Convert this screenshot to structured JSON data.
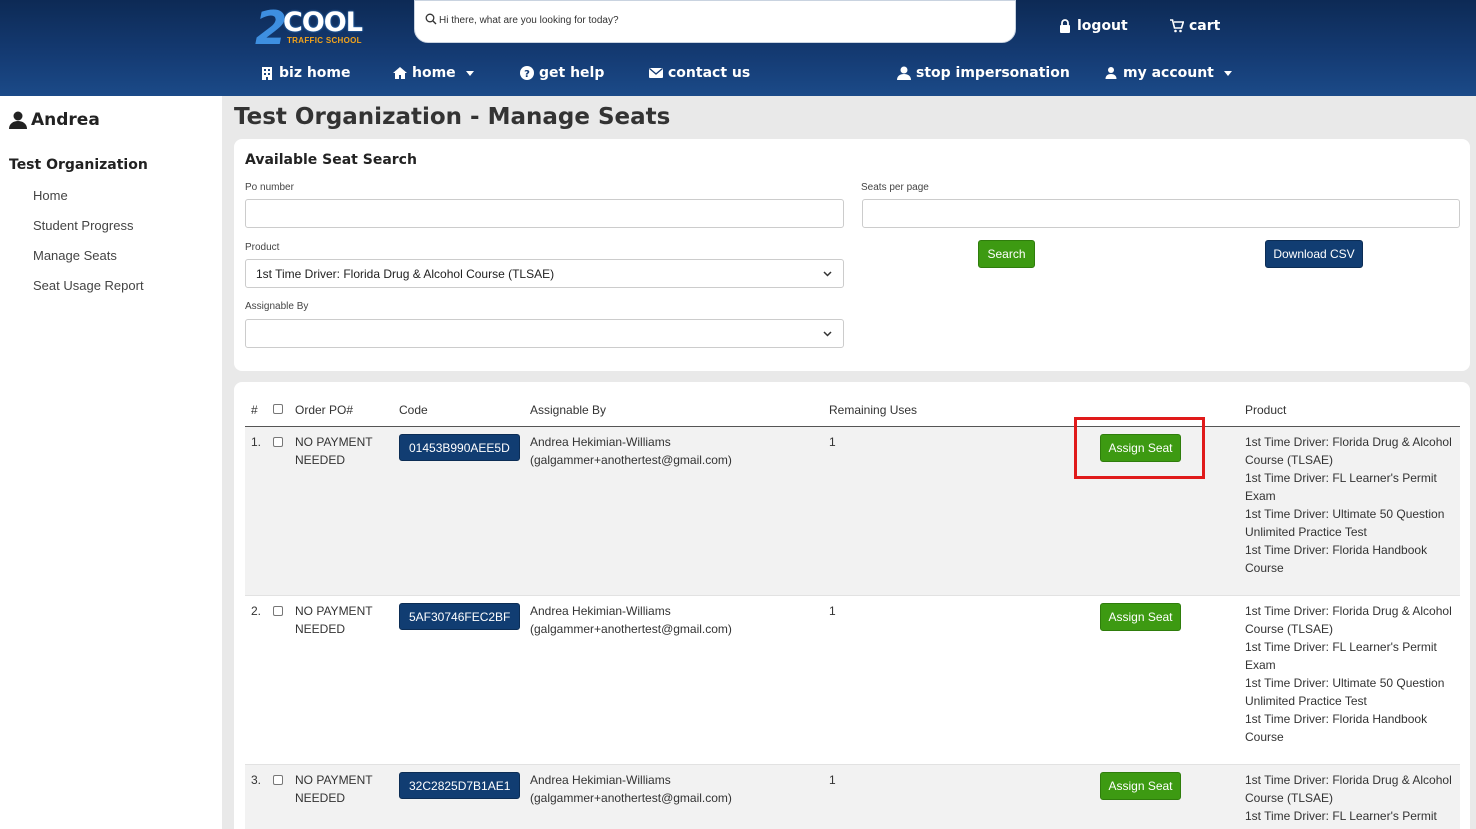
{
  "header": {
    "logo": {
      "two": "2",
      "cool": "COOL",
      "tagline": "TRAFFIC SCHOOL"
    },
    "search_placeholder": "Hi there, what are you looking for today?",
    "logout": "logout",
    "cart": "cart",
    "nav": {
      "biz_home": "biz home",
      "home": "home",
      "get_help": "get help",
      "contact_us": "contact us",
      "stop_impersonation": "stop impersonation",
      "my_account": "my account"
    }
  },
  "sidebar": {
    "user": "Andrea",
    "organization": "Test Organization",
    "items": [
      "Home",
      "Student Progress",
      "Manage Seats",
      "Seat Usage Report"
    ]
  },
  "page_title": "Test Organization - Manage Seats",
  "search_form": {
    "title": "Available Seat Search",
    "po_label": "Po number",
    "po_value": "",
    "seats_per_page_label": "Seats per page",
    "seats_per_page_value": "",
    "product_label": "Product",
    "product_value": "1st Time Driver: Florida Drug & Alcohol Course (TLSAE)",
    "assignable_label": "Assignable By",
    "assignable_value": "",
    "search_button": "Search",
    "download_button": "Download CSV"
  },
  "table": {
    "headers": {
      "num": "#",
      "order": "Order PO#",
      "code": "Code",
      "assignable": "Assignable By",
      "remaining": "Remaining Uses",
      "product": "Product"
    },
    "rows": [
      {
        "num": "1.",
        "order_line1": "NO PAYMENT",
        "order_line2": "NEEDED",
        "code": "01453B990AEE5D",
        "assignable_name": "Andrea Hekimian-Williams",
        "assignable_email": "(galgammer+anothertest@gmail.com)",
        "remaining": "1",
        "action": "Assign Seat",
        "product_lines": [
          "1st Time Driver: Florida Drug & Alcohol",
          "Course (TLSAE)",
          "1st Time Driver: FL Learner's Permit",
          "Exam",
          "1st Time Driver: Ultimate 50 Question",
          "Unlimited Practice Test",
          "1st Time Driver: Florida Handbook",
          "Course"
        ]
      },
      {
        "num": "2.",
        "order_line1": "NO PAYMENT",
        "order_line2": "NEEDED",
        "code": "5AF30746FEC2BF",
        "assignable_name": "Andrea Hekimian-Williams",
        "assignable_email": "(galgammer+anothertest@gmail.com)",
        "remaining": "1",
        "action": "Assign Seat",
        "product_lines": [
          "1st Time Driver: Florida Drug & Alcohol",
          "Course (TLSAE)",
          "1st Time Driver: FL Learner's Permit",
          "Exam",
          "1st Time Driver: Ultimate 50 Question",
          "Unlimited Practice Test",
          "1st Time Driver: Florida Handbook",
          "Course"
        ]
      },
      {
        "num": "3.",
        "order_line1": "NO PAYMENT",
        "order_line2": "NEEDED",
        "code": "32C2825D7B1AE1",
        "assignable_name": "Andrea Hekimian-Williams",
        "assignable_email": "(galgammer+anothertest@gmail.com)",
        "remaining": "1",
        "action": "Assign Seat",
        "product_lines": [
          "1st Time Driver: Florida Drug & Alcohol",
          "Course (TLSAE)",
          "1st Time Driver: FL Learner's Permit"
        ]
      }
    ]
  },
  "colors": {
    "header": "#143a72",
    "accent_green": "#3d9a12",
    "badge_blue": "#113d72",
    "highlight_red": "#e01a1a"
  }
}
